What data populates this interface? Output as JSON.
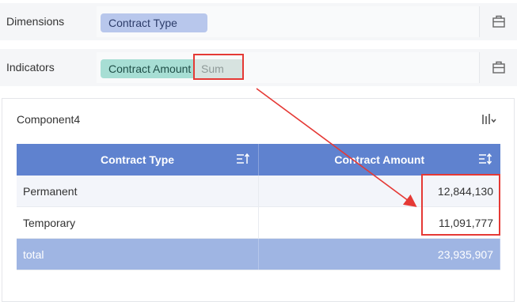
{
  "config": {
    "dimensions_label": "Dimensions",
    "dimension_field": "Contract Type",
    "indicators_label": "Indicators",
    "indicator_field": "Contract Amount",
    "indicator_agg": "Sum"
  },
  "component": {
    "title": "Component4",
    "columns": [
      "Contract Type",
      "Contract Amount"
    ],
    "rows": [
      {
        "type": "Permanent",
        "amount": "12,844,130"
      },
      {
        "type": "Temporary",
        "amount": "11,091,777"
      }
    ],
    "total": {
      "label": "total",
      "amount": "23,935,907"
    }
  },
  "annotation_color": "#e53935",
  "icons": {
    "dimensions_settings": "folder-icon",
    "indicators_settings": "folder-icon",
    "component_settings": "chart-settings-icon",
    "col1_sort": "sort-asc-icon",
    "col2_sort": "sort-both-icon"
  }
}
